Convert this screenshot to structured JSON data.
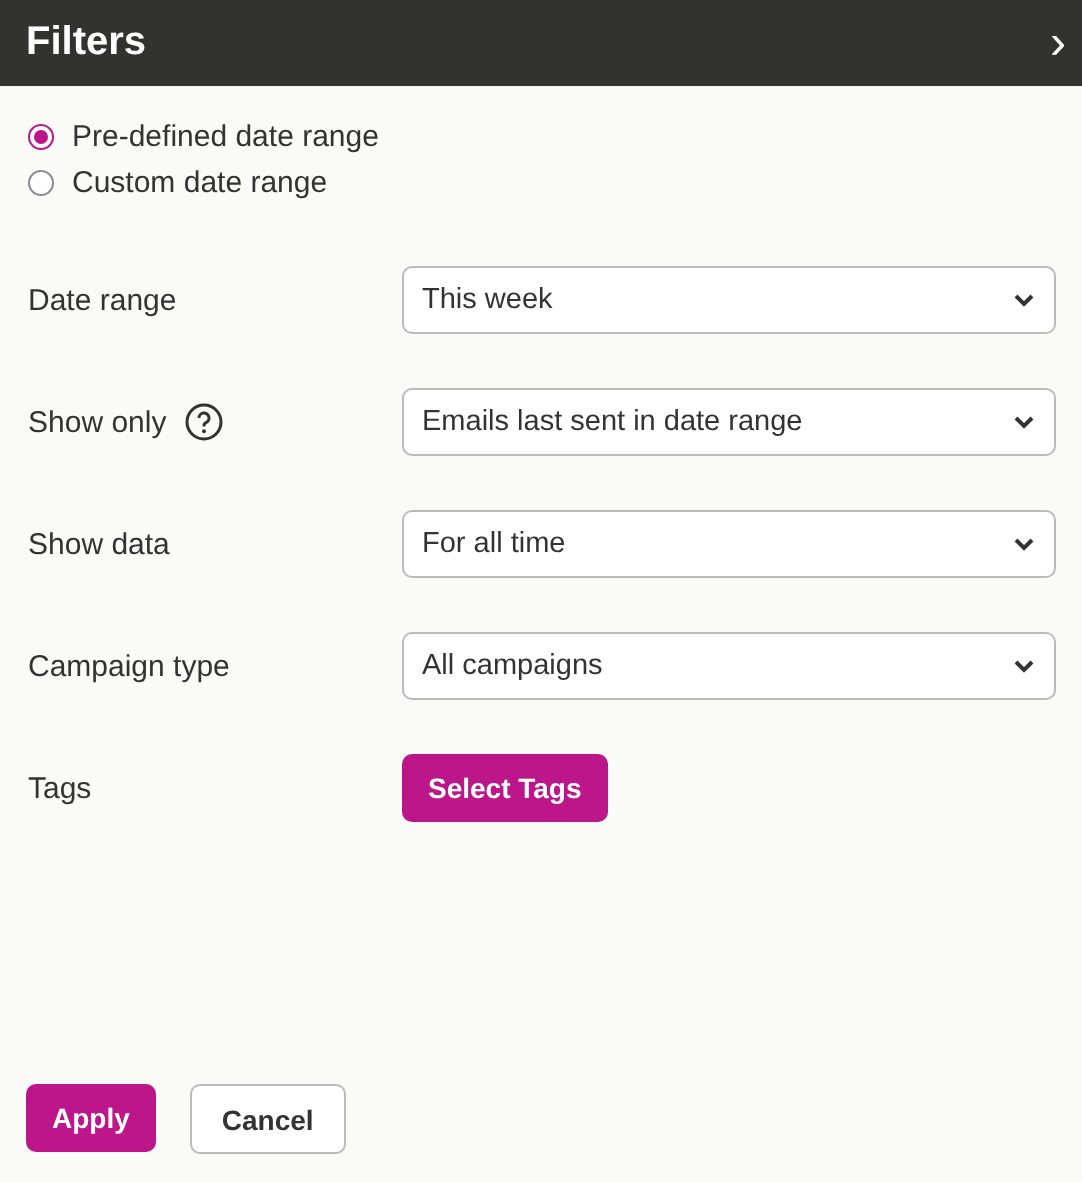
{
  "header": {
    "title": "Filters",
    "collapse_icon": "›"
  },
  "date_modes": [
    {
      "label": "Pre-defined date range",
      "selected": true
    },
    {
      "label": "Custom date range",
      "selected": false
    }
  ],
  "fields": [
    {
      "label": "Date range",
      "kind": "select",
      "value": "This week",
      "help": false
    },
    {
      "label": "Show only",
      "kind": "select",
      "value": "Emails last sent in date range",
      "help": true
    },
    {
      "label": "Show data",
      "kind": "select",
      "value": "For all time",
      "help": false
    },
    {
      "label": "Campaign type",
      "kind": "select",
      "value": "All campaigns",
      "help": false
    },
    {
      "label": "Tags",
      "kind": "button",
      "value": "Select Tags",
      "help": false
    }
  ],
  "actions": [
    {
      "label": "Apply",
      "kind": "primary"
    },
    {
      "label": "Cancel",
      "kind": "secondary"
    }
  ]
}
